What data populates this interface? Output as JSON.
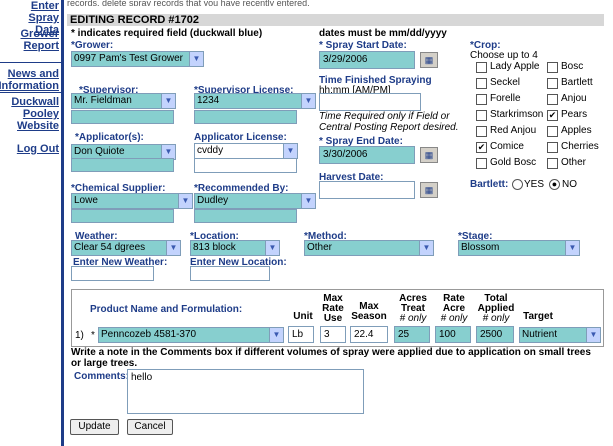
{
  "sidebar": {
    "items": [
      {
        "label_line1": "Enter Spray",
        "label_line2": "Data"
      },
      {
        "label_line1": "Grower",
        "label_line2": "Report"
      },
      {
        "label_line1": "News and",
        "label_line2": "Information"
      },
      {
        "label_line1": "Duckwall",
        "label_line2": "Pooley",
        "label_line3": "Website"
      },
      {
        "label_line1": "Log Out"
      }
    ]
  },
  "top_text": "records, delete spray records that you have recently entered.",
  "header": {
    "title": "EDITING RECORD #1702"
  },
  "notes": {
    "required": "* indicates required field (duckwall blue)",
    "date_format": "dates must be mm/dd/yyyy"
  },
  "grower": {
    "label": "*Grower:",
    "value": "0997   Pam's Test Grower"
  },
  "spray_start": {
    "label": "* Spray Start Date:",
    "value": "3/29/2006"
  },
  "supervisor": {
    "label": "*Supervisor:",
    "value": "Mr. Fieldman"
  },
  "supervisor_license": {
    "label": "*Supervisor License:",
    "value": "1234"
  },
  "time_finished": {
    "label": "Time Finished Spraying",
    "format": "hh:mm [AM/PM]",
    "note": "Time Required only if Field or Central Posting Report desired."
  },
  "applicator": {
    "label": "*Applicator(s):",
    "value": "Don Quiote"
  },
  "applicator_license": {
    "label": "Applicator License:",
    "value": "cvddy"
  },
  "spray_end": {
    "label": "* Spray End Date:",
    "value": "3/30/2006"
  },
  "chemical_supplier": {
    "label": "*Chemical Supplier:",
    "value": "Lowe"
  },
  "recommended_by": {
    "label": "*Recommended By:",
    "value": "Dudley"
  },
  "harvest_date": {
    "label": "Harvest Date:"
  },
  "crop": {
    "label": "*Crop:",
    "hint": "Choose up to 4",
    "options": [
      {
        "name": "Lady Apple",
        "checked": false
      },
      {
        "name": "Bosc",
        "checked": false
      },
      {
        "name": "Seckel",
        "checked": false
      },
      {
        "name": "Bartlett",
        "checked": false
      },
      {
        "name": "Forelle",
        "checked": false
      },
      {
        "name": "Anjou",
        "checked": false
      },
      {
        "name": "Starkrimson",
        "checked": false
      },
      {
        "name": "Pears",
        "checked": true
      },
      {
        "name": "Red Anjou",
        "checked": false
      },
      {
        "name": "Apples",
        "checked": false
      },
      {
        "name": "Comice",
        "checked": true
      },
      {
        "name": "Cherries",
        "checked": false
      },
      {
        "name": "Gold Bosc",
        "checked": false
      },
      {
        "name": "Other",
        "checked": false
      }
    ]
  },
  "bartlett": {
    "label": "Bartlett:",
    "yes": "YES",
    "no": "NO",
    "selected": "NO"
  },
  "weather": {
    "label": "Weather:",
    "value": "Clear 54 dgrees",
    "new_label": "Enter New Weather:"
  },
  "location": {
    "label": "*Location:",
    "value": "813 block",
    "new_label": "Enter New Location:"
  },
  "method": {
    "label": "*Method:",
    "value": "Other"
  },
  "stage": {
    "label": "*Stage:",
    "value": "Blossom"
  },
  "product_table": {
    "headers": {
      "product": "Product Name and Formulation:",
      "unit": "Unit",
      "max_rate": [
        "Max",
        "Rate",
        "Use"
      ],
      "max_season": [
        "Max",
        "Season"
      ],
      "acres_treat": [
        "Acres",
        "Treat",
        "# only"
      ],
      "rate_acre": [
        "Rate",
        "Acre",
        "# only"
      ],
      "total_applied": [
        "Total",
        "Applied",
        "# only"
      ],
      "target": "Target"
    },
    "rows": [
      {
        "num": "1)",
        "star": "*",
        "product": "Penncozeb 4581-370",
        "unit": "Lb",
        "max_rate": "3",
        "max_season": "22.4",
        "acres": "25",
        "rate": "100",
        "total": "2500",
        "target": "Nutrient"
      }
    ]
  },
  "note_text": "Write a note in the Comments box if different volumes of spray were applied due to application on small trees or large trees.",
  "comments": {
    "label": "Comments:",
    "value": "hello"
  },
  "buttons": {
    "update": "Update",
    "cancel": "Cancel"
  },
  "colors": {
    "accent": "#1e3c88",
    "field_bg": "#87cfcf",
    "header_bg": "#d7d7d7"
  }
}
